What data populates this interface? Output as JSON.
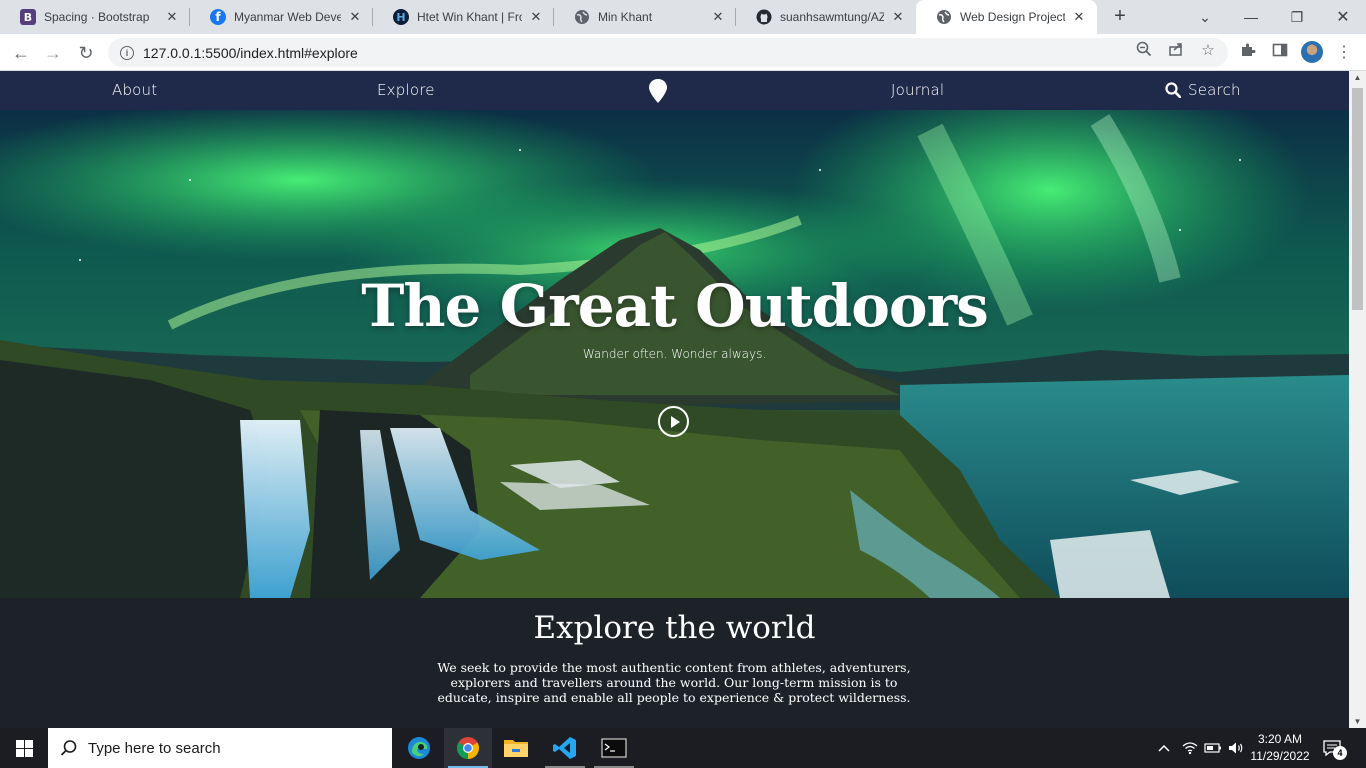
{
  "browser": {
    "tabs": [
      {
        "title": "Spacing · Bootstrap",
        "icon": "bootstrap-icon",
        "color": "#563d7c",
        "glyph": "B"
      },
      {
        "title": "Myanmar Web Develo",
        "icon": "facebook-icon",
        "color": "#1877f2",
        "glyph": "f"
      },
      {
        "title": "Htet Win Khant | Front",
        "icon": "portfolio-icon",
        "color": "#0b1e3a",
        "glyph": "H"
      },
      {
        "title": "Min Khant",
        "icon": "globe-icon",
        "color": "#5f6368",
        "glyph": ""
      },
      {
        "title": "suanhsawmtung/AZ-N",
        "icon": "github-icon",
        "color": "#24292f",
        "glyph": ""
      },
      {
        "title": "Web Design Project",
        "icon": "globe-icon",
        "color": "#5f6368",
        "glyph": ""
      }
    ],
    "url": "127.0.0.1:5500/index.html#explore"
  },
  "site": {
    "nav": {
      "about": "About",
      "explore": "Explore",
      "journal": "Journal",
      "search": "Search"
    },
    "hero": {
      "title": "The Great Outdoors",
      "subtitle": "Wander often. Wonder always."
    },
    "section": {
      "heading": "Explore the world",
      "body": "We seek to provide the most authentic content from athletes, adventurers, explorers and travellers around the world. Our long-term mission is to educate, inspire and enable all people to experience & protect wilderness."
    }
  },
  "taskbar": {
    "search_placeholder": "Type here to search",
    "time": "3:20 AM",
    "date": "11/29/2022",
    "notifications": "4"
  },
  "colors": {
    "nav_bg": "#1f2a4a",
    "section_bg": "#1d2228",
    "aurora": "#2bd86a"
  }
}
